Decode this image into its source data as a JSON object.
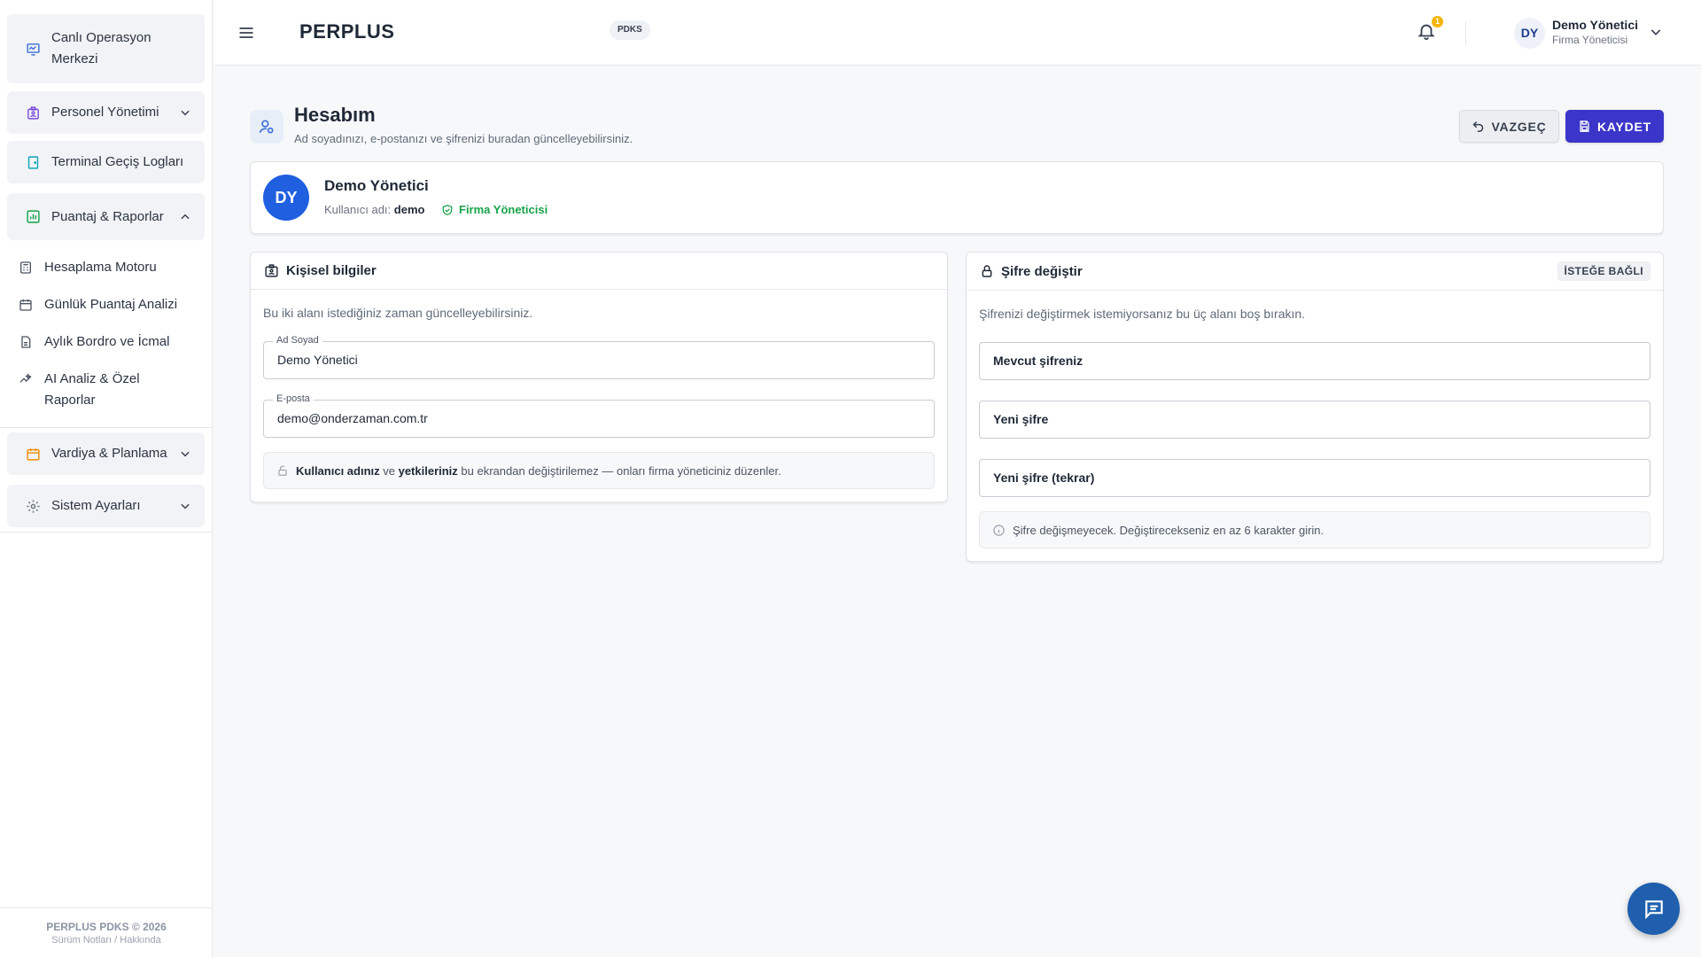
{
  "sidebar": {
    "items": [
      {
        "label": "Canlı Operasyon Merkezi"
      },
      {
        "label": "Personel Yönetimi"
      },
      {
        "label": "Terminal Geçiş Logları"
      },
      {
        "label": "Puantaj & Raporlar"
      },
      {
        "label": "Vardiya & Planlama"
      },
      {
        "label": "Sistem Ayarları"
      }
    ],
    "sub_items": [
      {
        "label": "Hesaplama Motoru"
      },
      {
        "label": "Günlük Puantaj Analizi"
      },
      {
        "label": "Aylık Bordro ve İcmal"
      },
      {
        "label": "AI Analiz & Özel Raporlar"
      }
    ],
    "footer": {
      "line1": "PERPLUS PDKS © 2026",
      "line2": "Sürüm Notları / Hakkında"
    }
  },
  "topbar": {
    "brand": "PERPLUS",
    "badge": "PDKS",
    "notification_count": "1",
    "user_initials": "DY",
    "user_name": "Demo Yönetici",
    "user_role": "Firma Yöneticisi"
  },
  "page": {
    "title": "Hesabım",
    "subtitle": "Ad soyadınızı, e-postanızı ve şifrenizi buradan güncelleyebilirsiniz.",
    "cancel_label": "VAZGEÇ",
    "save_label": "KAYDET"
  },
  "profile": {
    "initials": "DY",
    "name": "Demo Yönetici",
    "username_label": "Kullanıcı adı:",
    "username": "demo",
    "role": "Firma Yöneticisi"
  },
  "personal": {
    "title": "Kişisel bilgiler",
    "description": "Bu iki alanı istediğiniz zaman güncelleyebilirsiniz.",
    "fullname_label": "Ad Soyad",
    "fullname_value": "Demo Yönetici",
    "email_label": "E-posta",
    "email_value": "demo@onderzaman.com.tr",
    "note_b1": "Kullanıcı adınız",
    "note_t1": " ve ",
    "note_b2": "yetkileriniz",
    "note_t2": " bu ekrandan değiştirilemez — onları firma yöneticiniz düzenler."
  },
  "password": {
    "title": "Şifre değiştir",
    "badge": "İSTEĞE BAĞLI",
    "description": "Şifrenizi değiştirmek istemiyorsanız bu üç alanı boş bırakın.",
    "current_placeholder": "Mevcut şifreniz",
    "new_placeholder": "Yeni şifre",
    "repeat_placeholder": "Yeni şifre (tekrar)",
    "info": "Şifre değişmeyecek. Değiştirecekseniz en az 6 karakter girin."
  },
  "colors": {
    "accent": "#3b36c9",
    "avatar": "#1f5fe0",
    "role_green": "#16a34a",
    "fab": "#1f5fae"
  }
}
